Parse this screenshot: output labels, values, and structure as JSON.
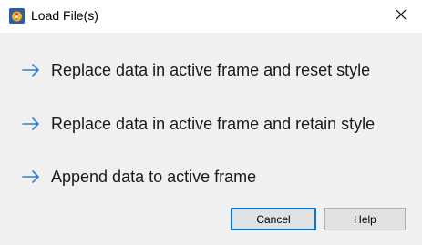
{
  "window": {
    "title": "Load File(s)",
    "close_icon": "close-icon",
    "app_icon": "tecplot-app-icon"
  },
  "options": [
    {
      "label": "Replace data in active frame and reset style",
      "icon": "arrow-right-icon"
    },
    {
      "label": "Replace data in active frame and retain style",
      "icon": "arrow-right-icon"
    },
    {
      "label": "Append data to active frame",
      "icon": "arrow-right-icon"
    }
  ],
  "buttons": {
    "cancel_label": "Cancel",
    "help_label": "Help"
  },
  "colors": {
    "accent": "#0078d7",
    "dialog_background": "#f0f0f0",
    "titlebar_background": "#ffffff",
    "button_background": "#e1e1e1"
  }
}
